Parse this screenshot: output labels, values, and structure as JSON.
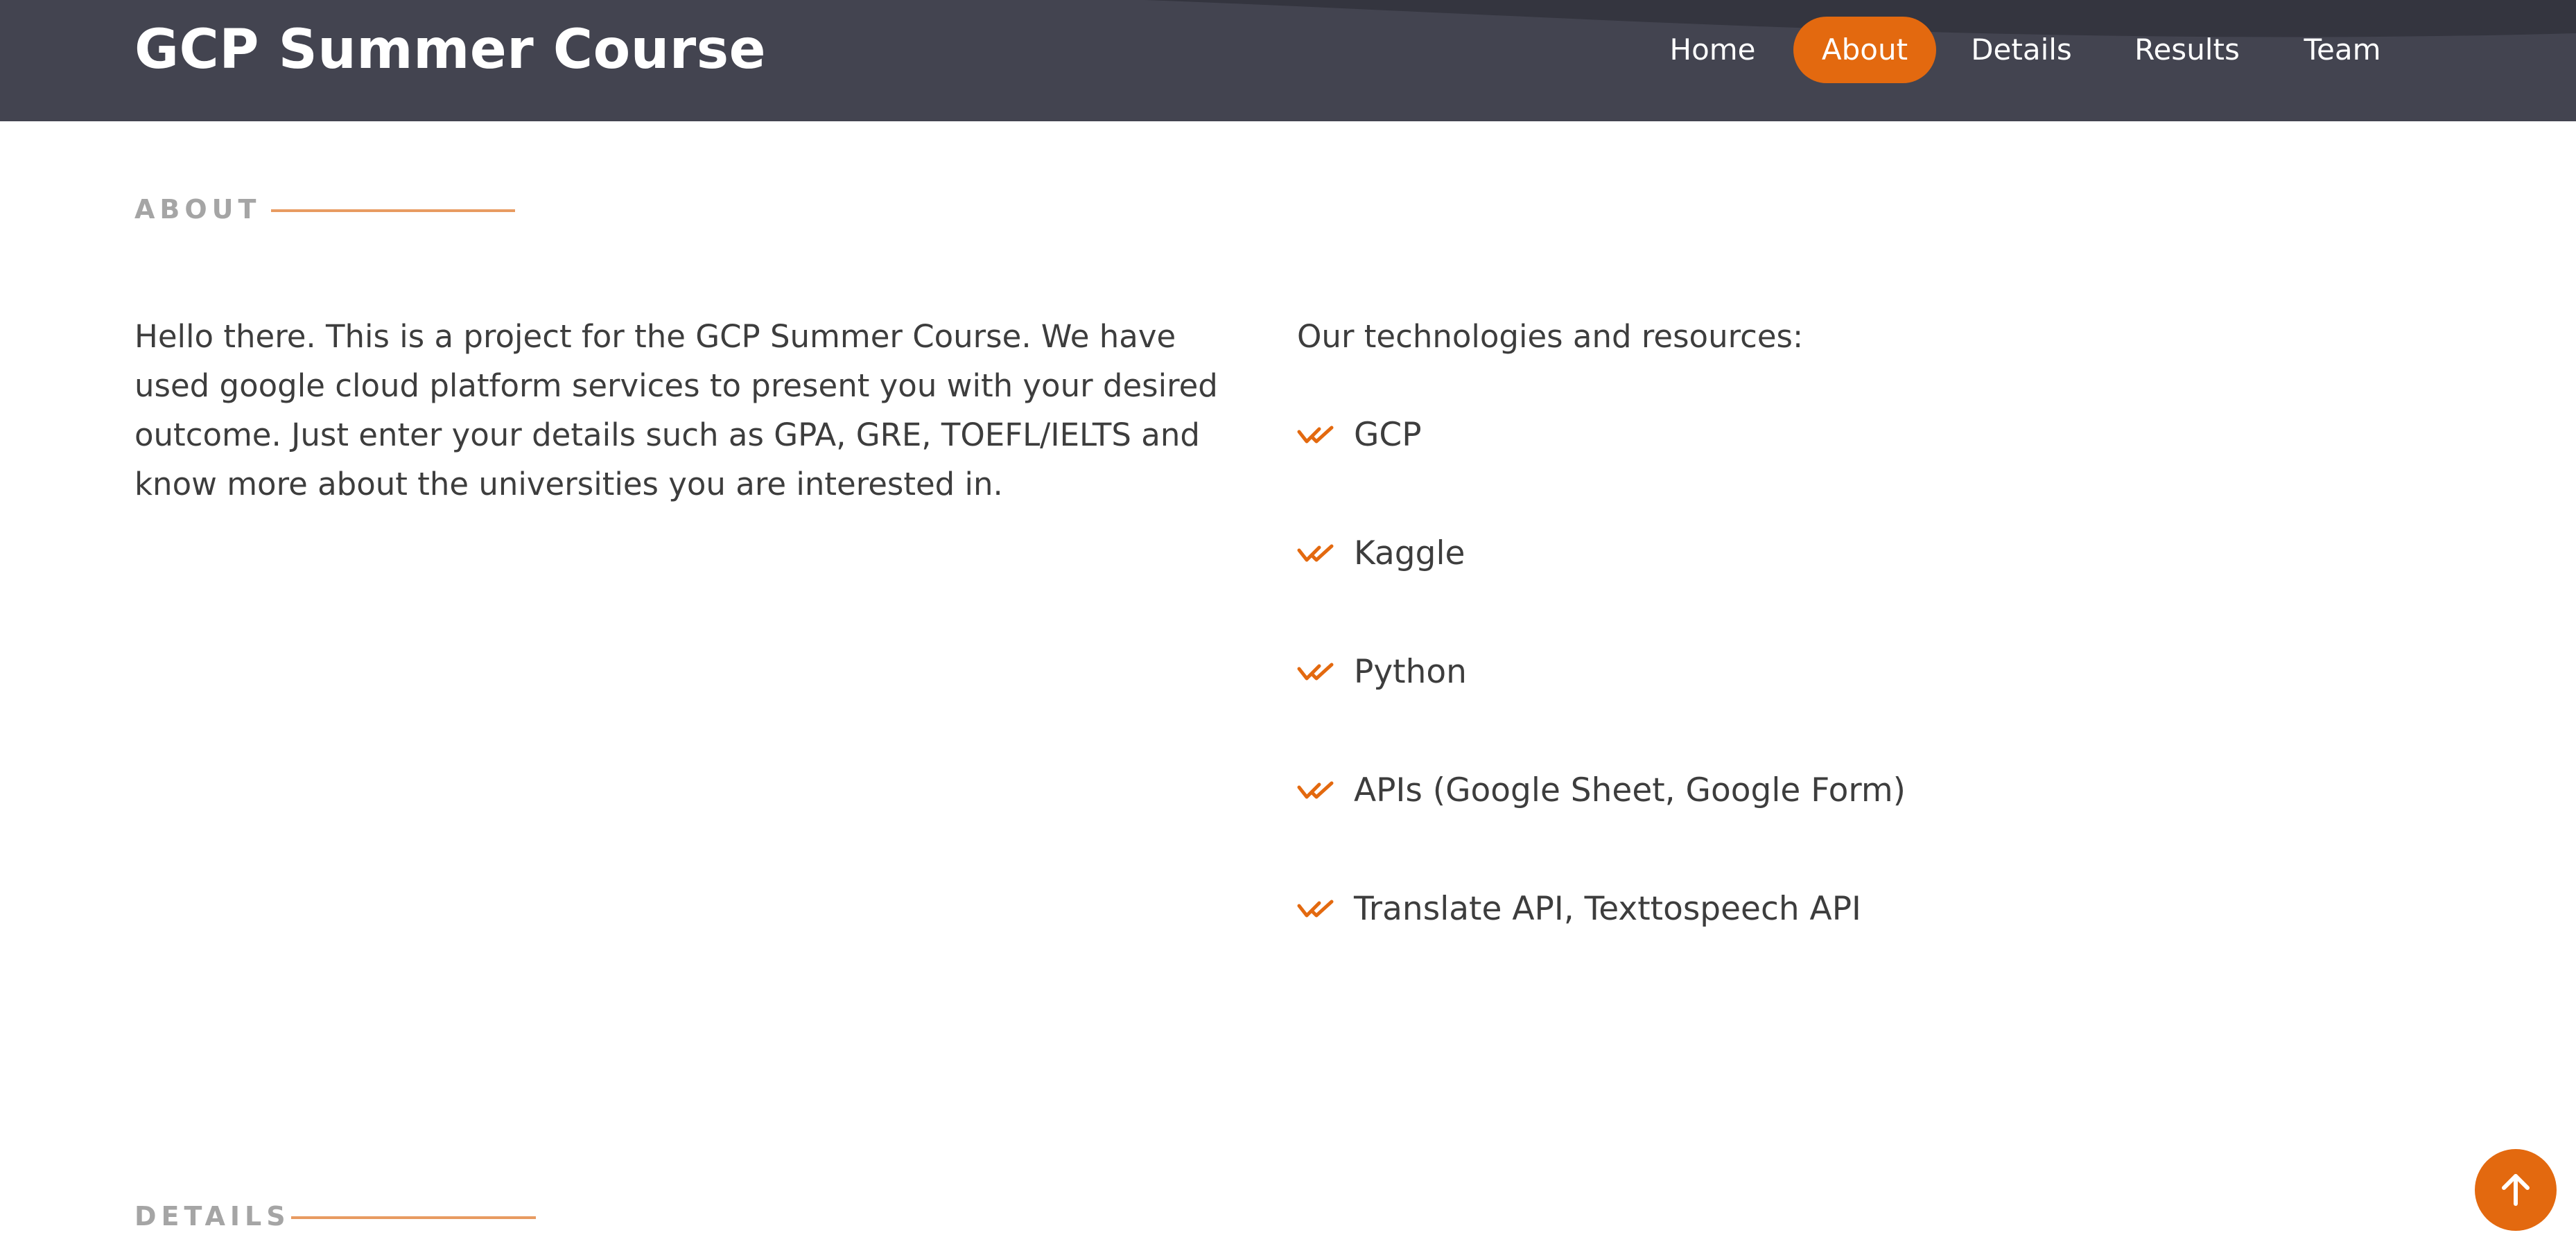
{
  "header": {
    "brand": "GCP Summer Course",
    "nav": [
      {
        "label": "Home",
        "active": false
      },
      {
        "label": "About",
        "active": true
      },
      {
        "label": "Details",
        "active": false
      },
      {
        "label": "Results",
        "active": false
      },
      {
        "label": "Team",
        "active": false
      }
    ]
  },
  "about": {
    "section_title": "ABOUT",
    "paragraph": "Hello there. This is a project for the GCP Summer Course. We have used google cloud platform services to present you with your desired outcome. Just enter your details such as GPA, GRE, TOEFL/IELTS and know more about the universities you are interested in.",
    "tech_heading": "Our technologies and resources:",
    "tech_items": [
      "GCP",
      "Kaggle",
      "Python",
      "APIs (Google Sheet, Google Form)",
      "Translate API, Texttospeech API"
    ]
  },
  "details": {
    "section_title": "DETAILS"
  },
  "colors": {
    "header_bg": "#434450",
    "accent": "#e3690f",
    "section_title": "#a5a5a5",
    "body_text": "#3d3d3d"
  },
  "icons": {
    "list_bullet": "double-check-icon",
    "scroll_top": "arrow-up-icon"
  }
}
